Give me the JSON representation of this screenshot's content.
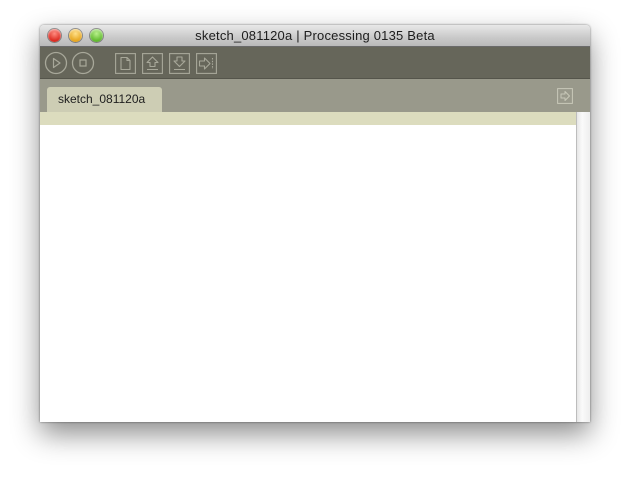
{
  "window": {
    "title": "sketch_081120a | Processing 0135 Beta"
  },
  "toolbar": {
    "buttons": [
      {
        "name": "run",
        "icon": "play-icon"
      },
      {
        "name": "stop",
        "icon": "stop-icon"
      },
      {
        "name": "new",
        "icon": "new-file-icon"
      },
      {
        "name": "open",
        "icon": "open-arrow-up-icon"
      },
      {
        "name": "save",
        "icon": "save-arrow-down-icon"
      },
      {
        "name": "export",
        "icon": "export-arrow-right-icon"
      }
    ]
  },
  "tabs": [
    {
      "label": "sketch_081120a",
      "active": true
    }
  ],
  "editor": {
    "content": ""
  },
  "colors": {
    "toolbar_bg": "#66665a",
    "tabbar_bg": "#99998b",
    "active_tab_bg": "#cdcdb4",
    "status_strip_bg": "#dcdcbe",
    "editor_bg": "#ffffff",
    "icon_stroke": "#a8a89a"
  }
}
